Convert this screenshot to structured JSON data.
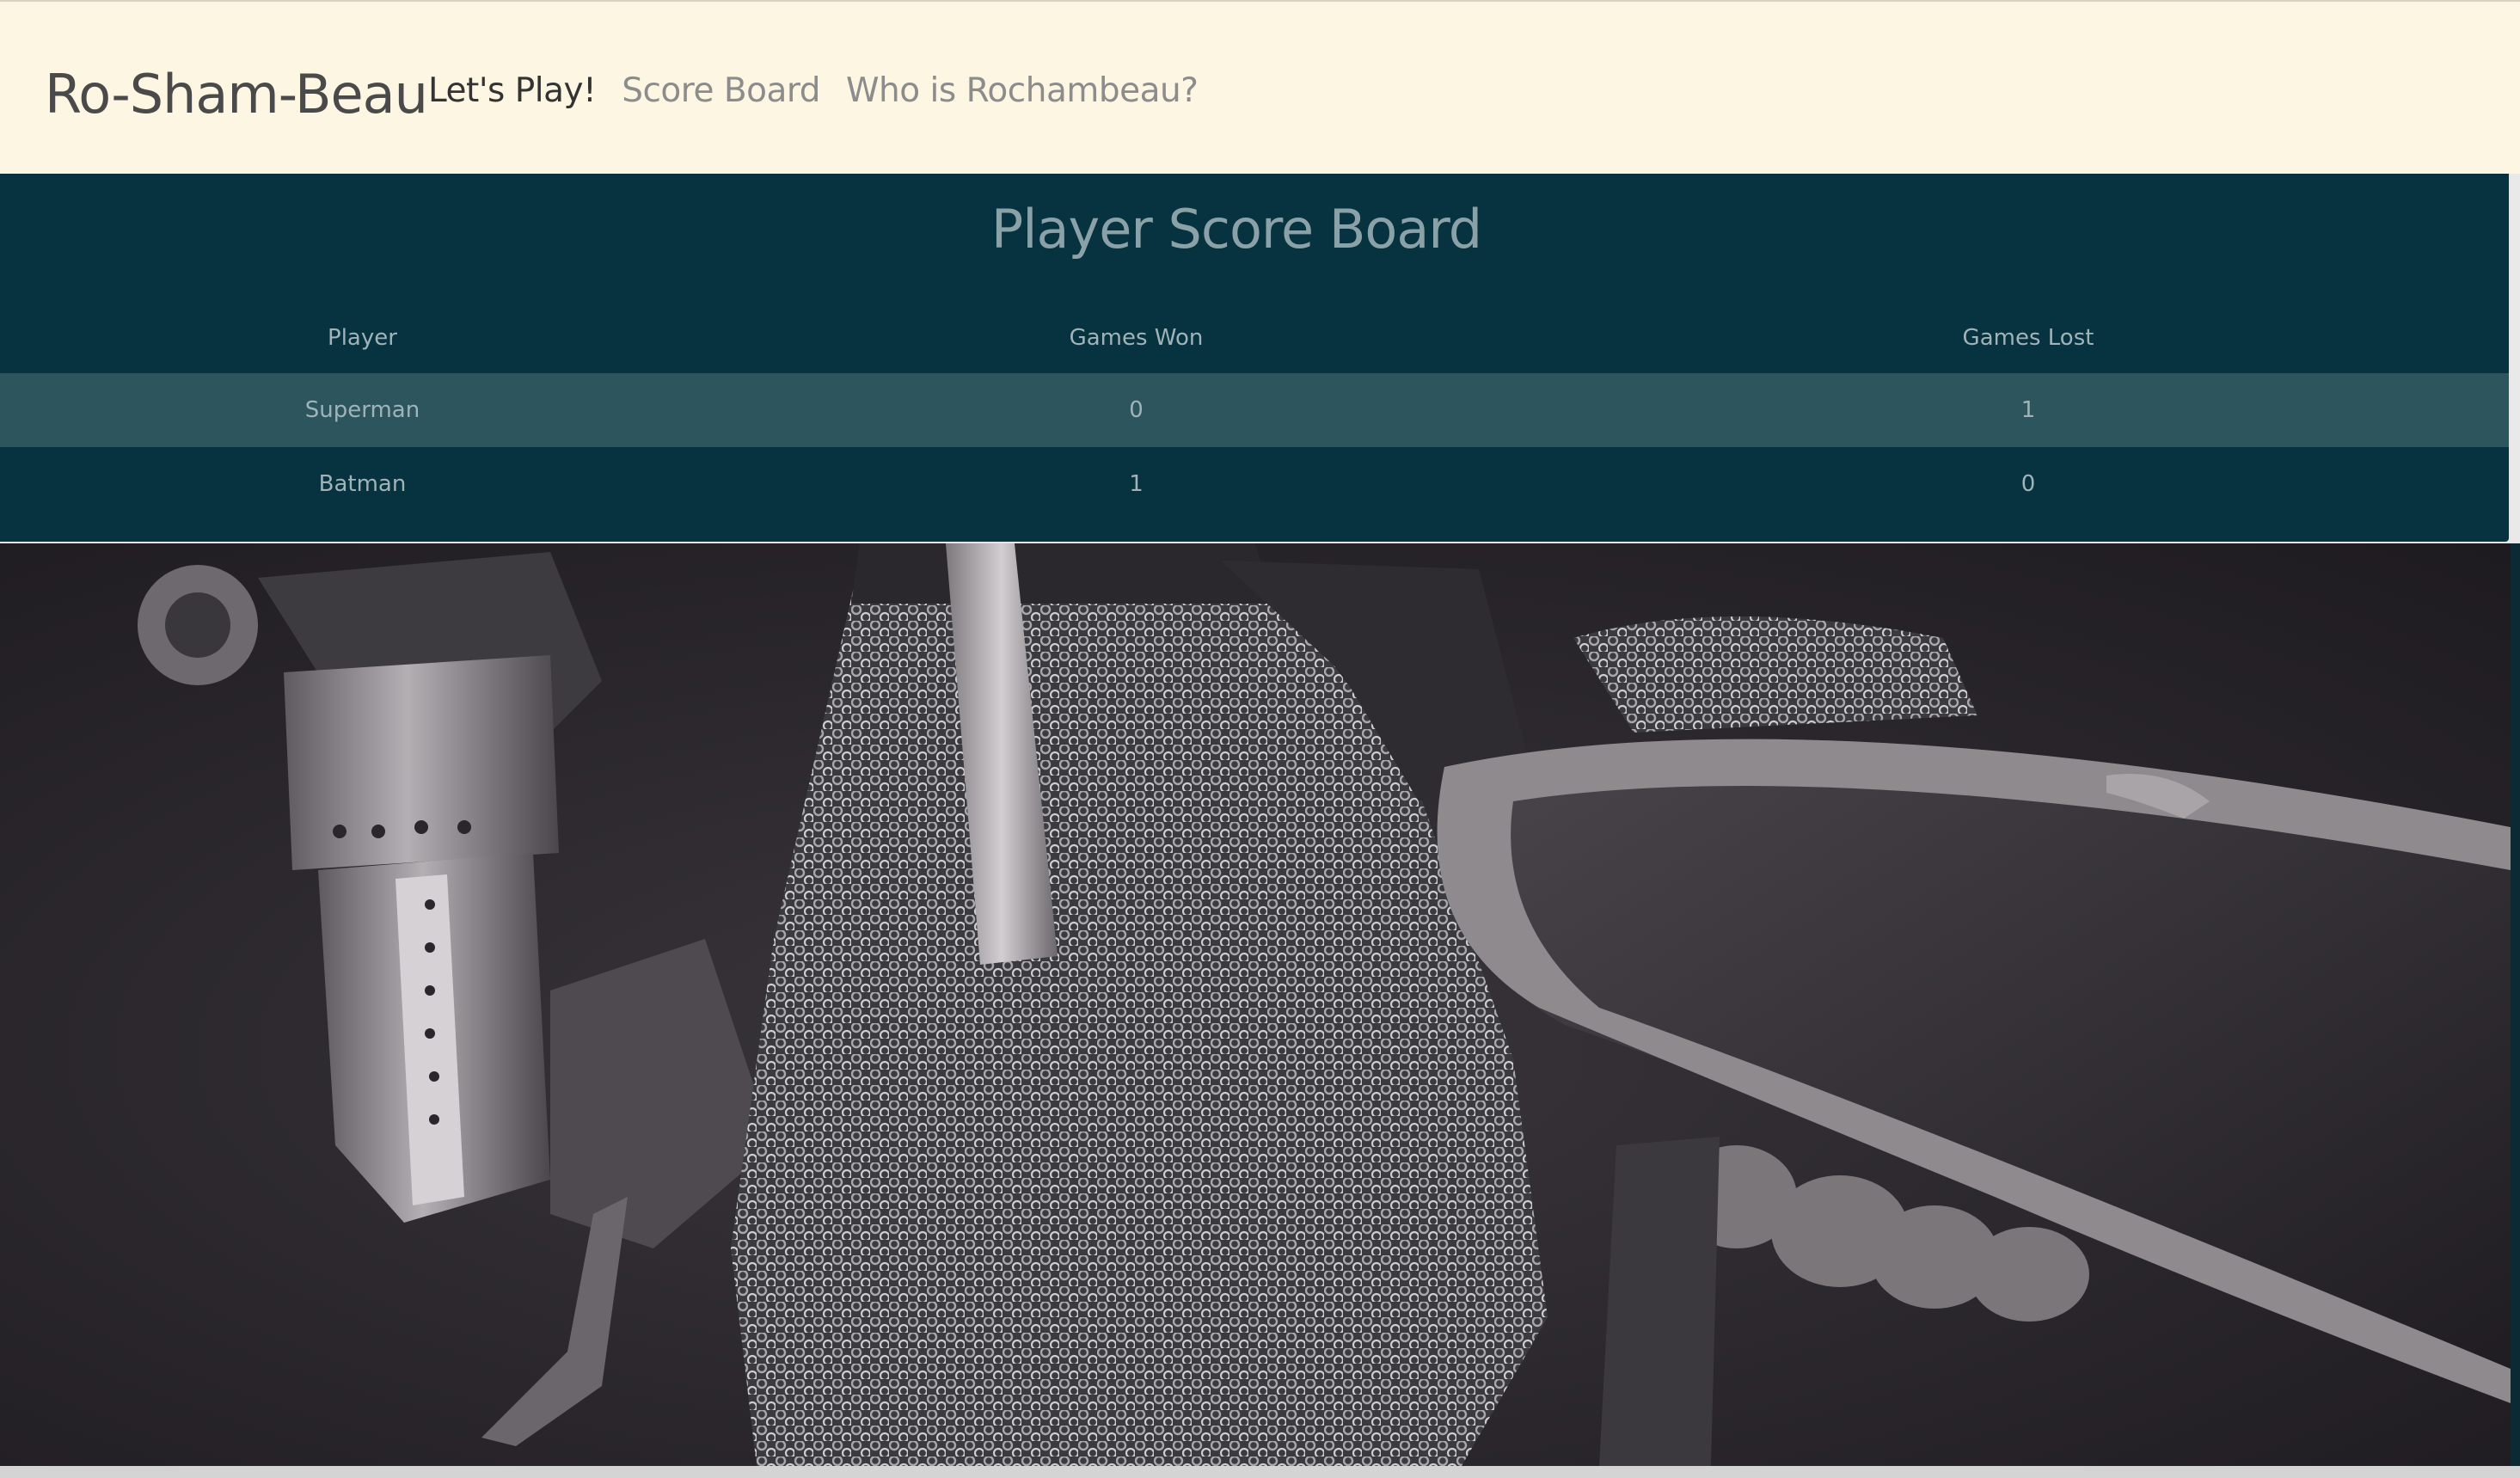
{
  "navbar": {
    "brand": "Ro-Sham-Beau",
    "links": [
      {
        "label": "Let's Play!",
        "active": true
      },
      {
        "label": "Score Board",
        "active": false
      },
      {
        "label": "Who is Rochambeau?",
        "active": false
      }
    ]
  },
  "scoreboard": {
    "title": "Player Score Board",
    "columns": [
      "Player",
      "Games Won",
      "Games Lost"
    ],
    "rows": [
      {
        "player": "Superman",
        "won": "0",
        "lost": "1"
      },
      {
        "player": "Batman",
        "won": "1",
        "lost": "0"
      }
    ]
  },
  "hero": {
    "subject": "knight in chainmail holding a shield"
  },
  "colors": {
    "navbar_bg": "#fdf6e3",
    "board_bg": "#07323f",
    "row_highlight": "#2c555e",
    "title_text": "#8aa1a8"
  }
}
